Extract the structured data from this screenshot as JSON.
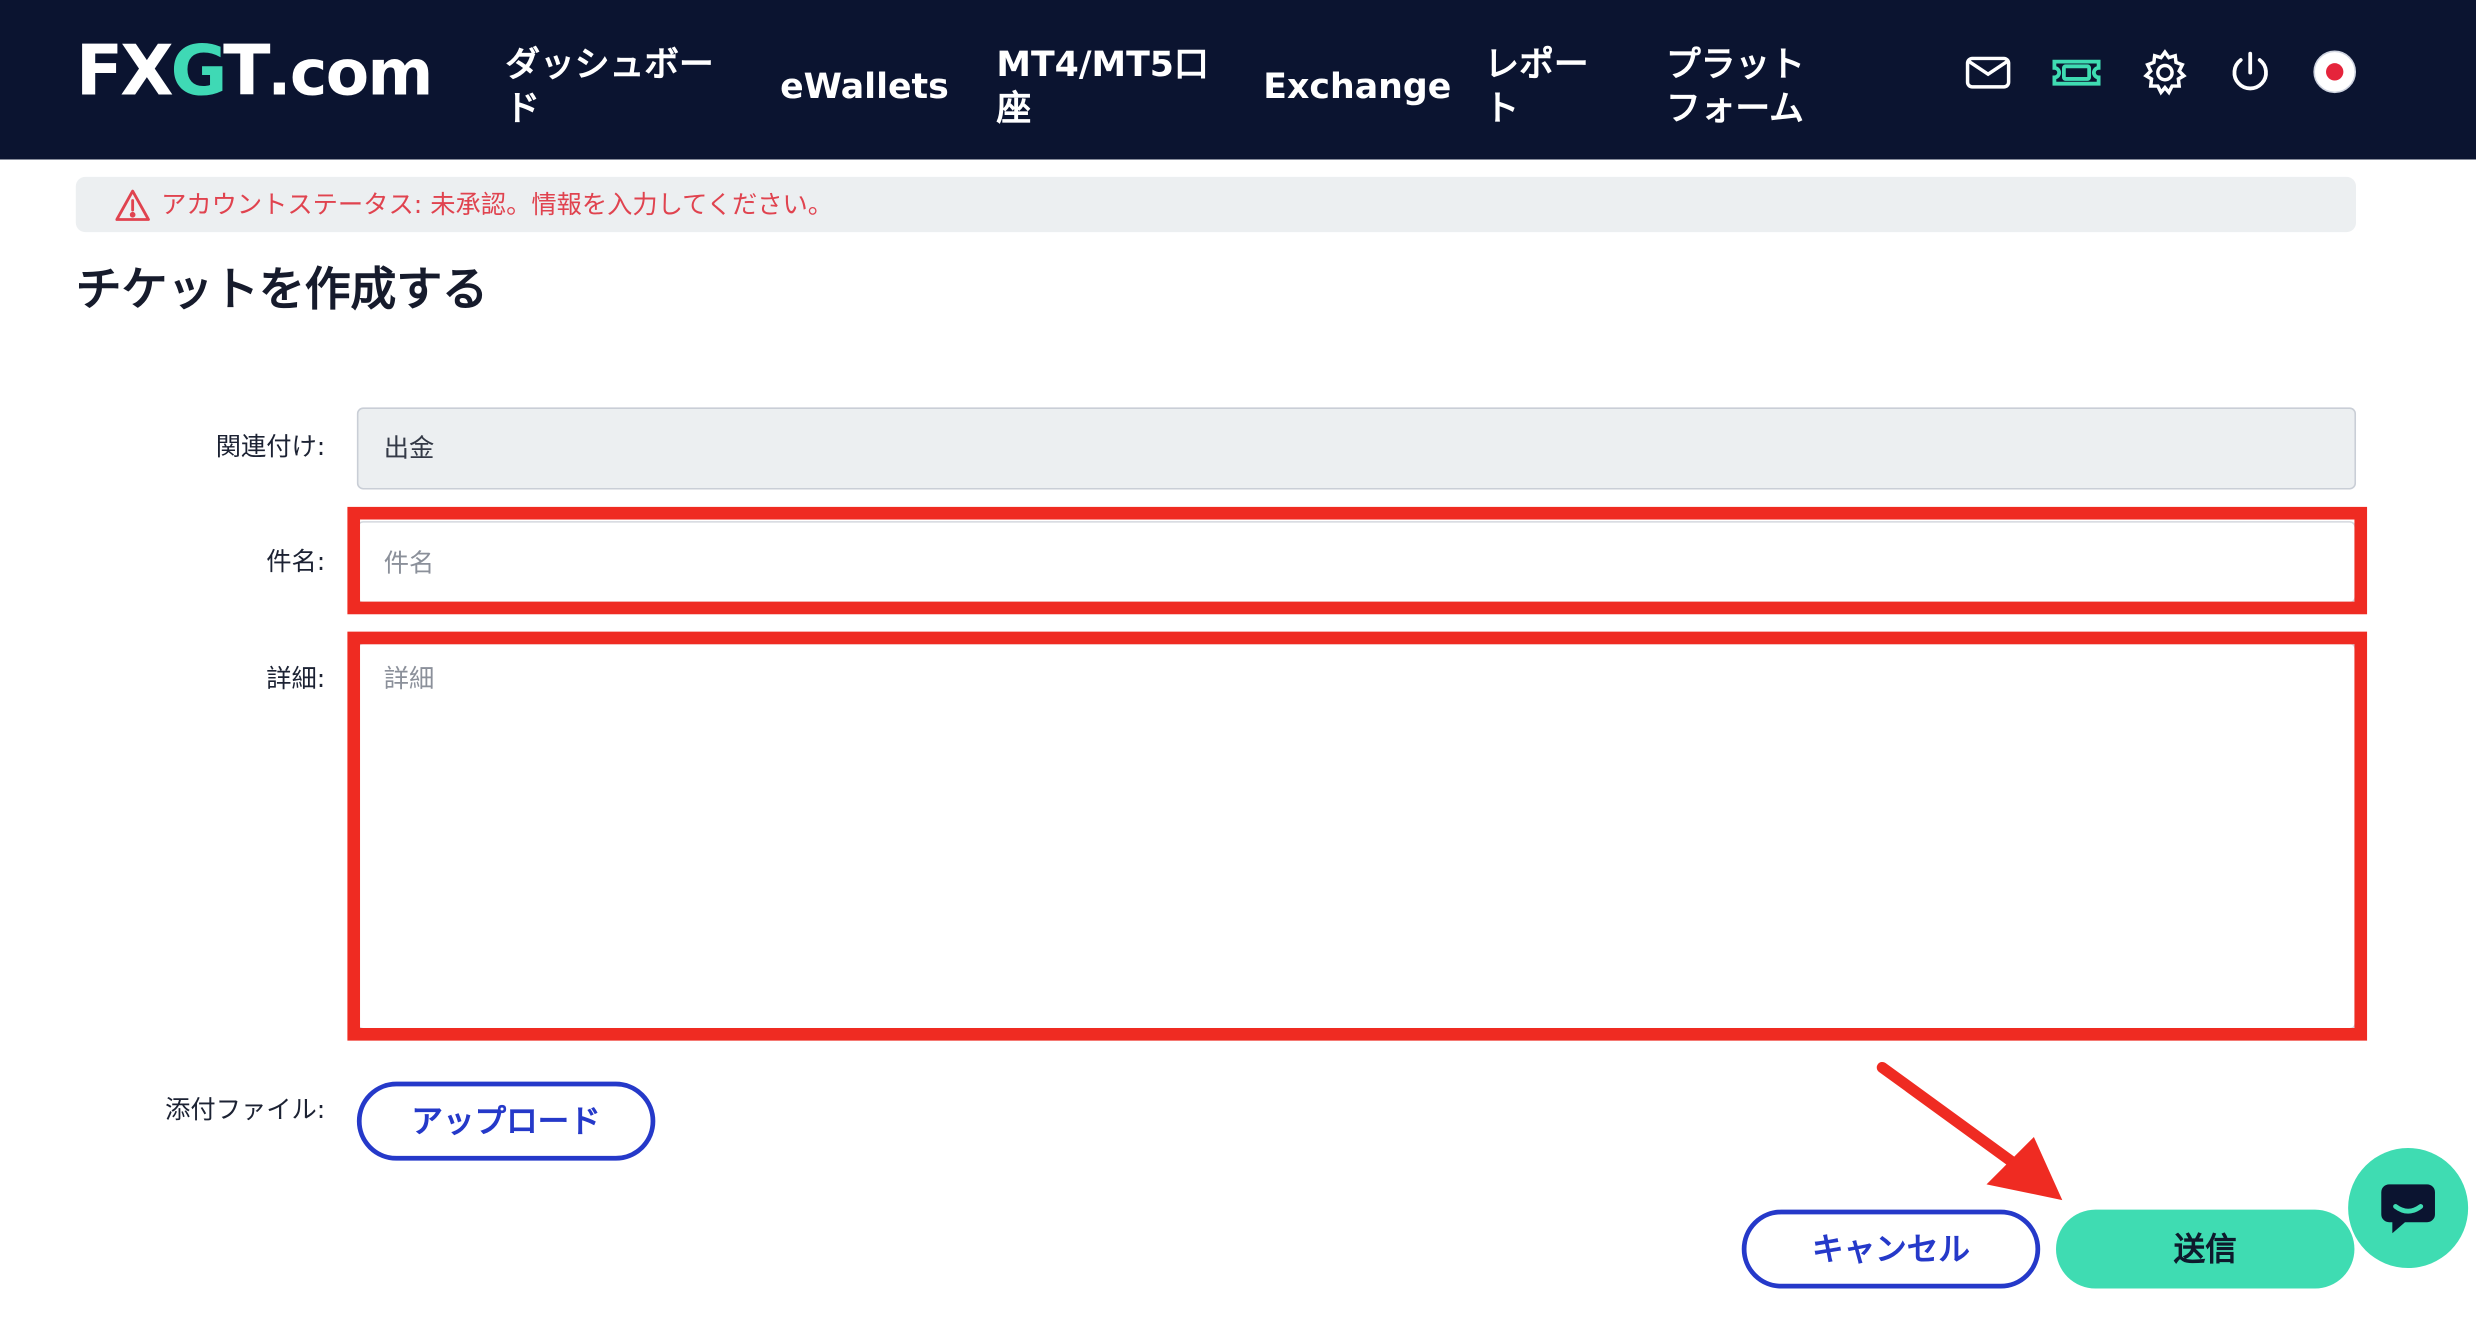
{
  "header": {
    "logo_fx": "FX",
    "logo_g": "G",
    "logo_t": "T",
    "logo_com": ".com",
    "nav": [
      {
        "label_line1": "ダッシュボー",
        "label_line2": "ド"
      },
      {
        "label_line1": "eWallets"
      },
      {
        "label_line1": "MT4/MT5口",
        "label_line2": "座"
      },
      {
        "label_line1": "Exchange"
      },
      {
        "label_line1": "レポー",
        "label_line2": "ト"
      },
      {
        "label_line1": "プラット",
        "label_line2": "フォーム"
      }
    ],
    "icons": [
      "mail-icon",
      "ticket-icon",
      "gear-icon",
      "power-icon",
      "japan-flag-icon"
    ]
  },
  "alert": {
    "text": "アカウントステータス: 未承認。情報を入力してください。",
    "color": "#e0434f"
  },
  "page": {
    "title": "チケットを作成する"
  },
  "form": {
    "related_label": "関連付け:",
    "related_value": "出金",
    "subject_label": "件名:",
    "subject_placeholder": "件名",
    "subject_value": "",
    "details_label": "詳細:",
    "details_placeholder": "詳細",
    "details_value": "",
    "attachment_label": "添付ファイル:",
    "upload_label": "アップロード",
    "cancel_label": "キャンセル",
    "submit_label": "送信"
  },
  "colors": {
    "nav_bg": "#0b1430",
    "accent": "#3fdcb2",
    "link_blue": "#2539c9",
    "highlight_red": "#ef2b22"
  }
}
